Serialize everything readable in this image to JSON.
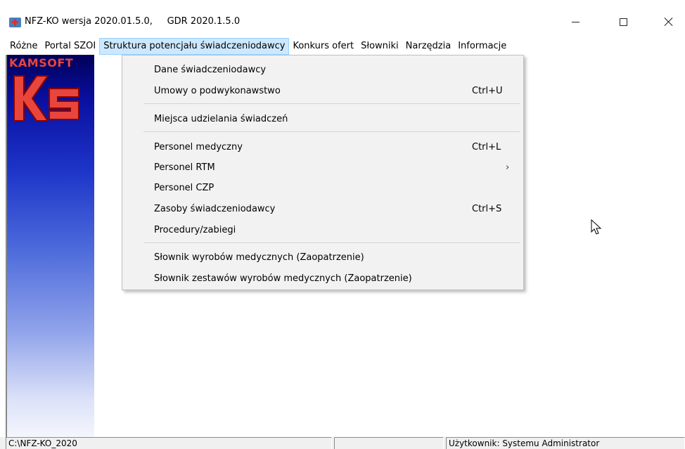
{
  "window": {
    "title": "NFZ-KO wersja 2020.01.5.0,     GDR 2020.1.5.0",
    "icon": "medical-kit-icon"
  },
  "menubar": {
    "items": [
      {
        "label": "Różne"
      },
      {
        "label": "Portal SZOI"
      },
      {
        "label": "Struktura potencjału świadczeniodawcy",
        "active": true
      },
      {
        "label": "Konkurs ofert"
      },
      {
        "label": "Słowniki"
      },
      {
        "label": "Narzędzia"
      },
      {
        "label": "Informacje"
      }
    ]
  },
  "sidebar": {
    "brand": "KAMSOFT",
    "logo_text": "KS",
    "colors": {
      "brand": "#e8453c",
      "gradient_top": "#00005a",
      "gradient_bottom": "#f4f6fd"
    }
  },
  "dropdown": {
    "items": [
      {
        "label": "Dane świadczeniodawcy",
        "shortcut": ""
      },
      {
        "label": "Umowy o podwykonawstwo",
        "shortcut": "Ctrl+U"
      },
      {
        "label": "Miejsca udzielania świadczeń",
        "shortcut": ""
      },
      {
        "label": "Personel medyczny",
        "shortcut": "Ctrl+L"
      },
      {
        "label": "Personel RTM",
        "shortcut": "",
        "submenu": true
      },
      {
        "label": "Personel CZP",
        "shortcut": ""
      },
      {
        "label": "Zasoby świadczeniodawcy",
        "shortcut": "Ctrl+S"
      },
      {
        "label": "Procedury/zabiegi",
        "shortcut": ""
      },
      {
        "label": "Słownik wyrobów medycznych (Zaopatrzenie)",
        "shortcut": ""
      },
      {
        "label": "Słownik zestawów wyrobów medycznych (Zaopatrzenie)",
        "shortcut": ""
      }
    ]
  },
  "statusbar": {
    "path": "C:\\NFZ-KO_2020",
    "middle": "",
    "user": "Użytkownik: Systemu Administrator"
  }
}
